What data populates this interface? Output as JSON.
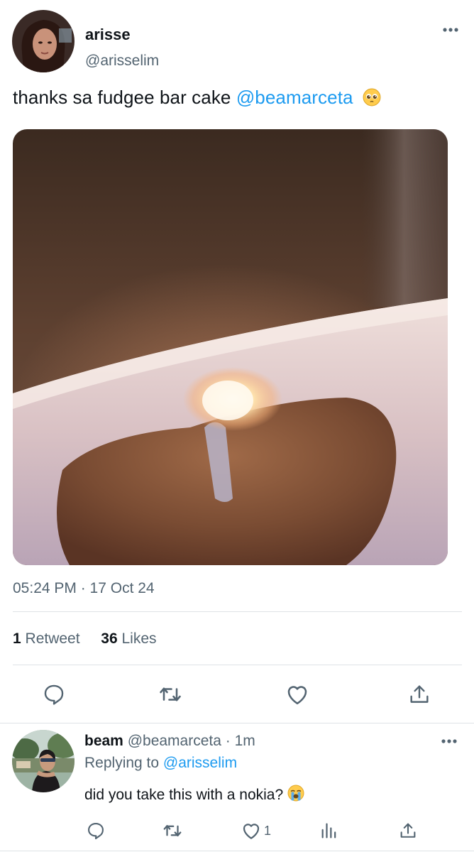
{
  "tweet": {
    "display_name": "arisse",
    "handle": "@arisselim",
    "text": "thanks sa fudgee bar cake ",
    "mention": "@beamarceta",
    "emoji_icon": "pleading-face-emoji",
    "timestamp": "05:24 PM · 17 Oct 24",
    "retweet_count": "1",
    "retweet_label": "Retweet",
    "like_count": "36",
    "like_label": "Likes",
    "media_icon": "candle-cake-photo"
  },
  "actions": {
    "reply_icon": "reply-icon",
    "retweet_icon": "retweet-icon",
    "like_icon": "heart-icon",
    "share_icon": "share-icon"
  },
  "reply": {
    "display_name": "beam",
    "handle": "@beamarceta",
    "time": "· 1m",
    "replying_prefix": "Replying to ",
    "replying_to": "@arisselim",
    "text": "did you take this with a nokia? ",
    "emoji_icon": "loudly-crying-emoji",
    "like_count": "1"
  },
  "colors": {
    "accent": "#1d9bf0",
    "text": "#0f1419",
    "secondary": "#536471",
    "divider": "#dfe3e6"
  }
}
